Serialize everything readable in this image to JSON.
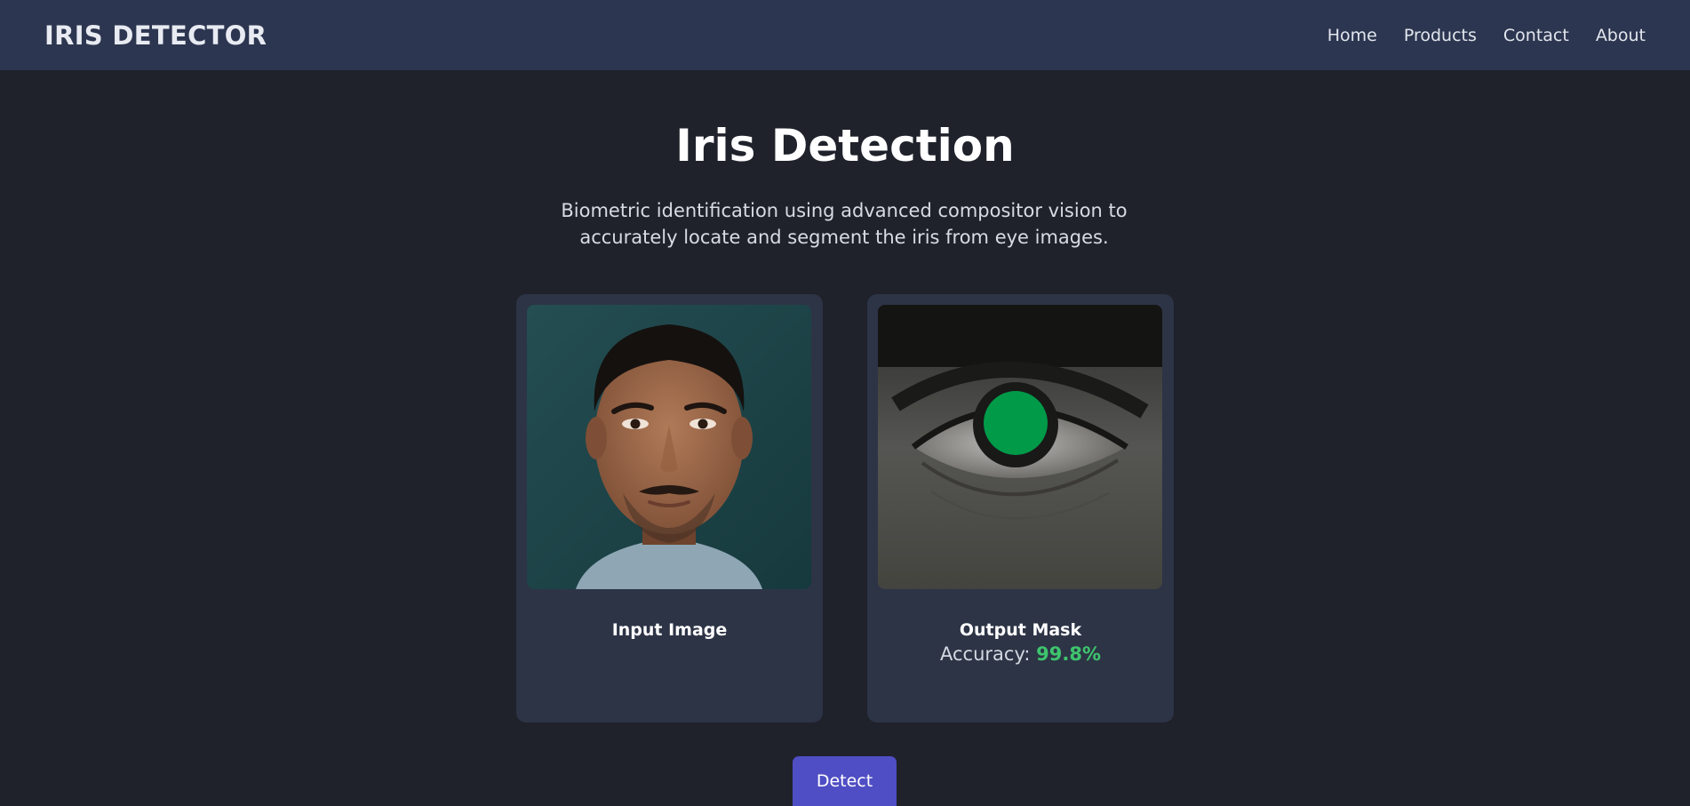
{
  "header": {
    "brand": "IRIS DETECTOR",
    "nav": [
      "Home",
      "Products",
      "Contact",
      "About"
    ]
  },
  "hero": {
    "title": "Iris Detection",
    "description": "Biometric identification using advanced compositor vision to accurately locate and segment the iris from eye images."
  },
  "cards": {
    "input": {
      "title": "Input Image"
    },
    "output": {
      "title": "Output Mask",
      "accuracy_label": "Accuracy:",
      "accuracy_value": "99.8%"
    }
  },
  "actions": {
    "detect_label": "Detect"
  },
  "colors": {
    "header_bg": "#2d3650",
    "page_bg": "#1f222b",
    "card_bg": "#2d3446",
    "accent": "#4f4ec4",
    "success": "#3ec46d",
    "mask_fill": "#009a49"
  }
}
